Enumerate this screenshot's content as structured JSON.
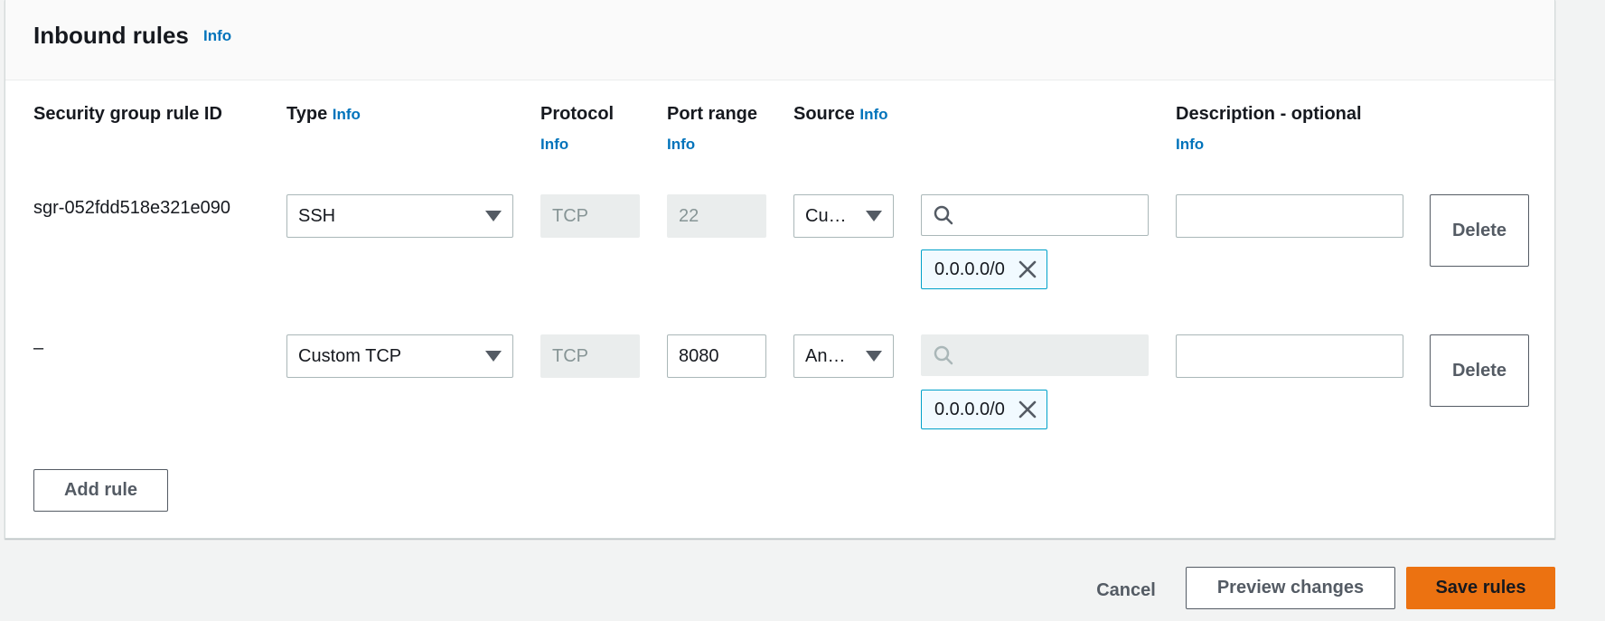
{
  "panel": {
    "title": "Inbound rules",
    "title_info": "Info"
  },
  "columns": {
    "rule_id": "Security group rule ID",
    "type": "Type",
    "type_info": "Info",
    "protocol": "Protocol",
    "protocol_info": "Info",
    "port_range": "Port range",
    "port_range_info": "Info",
    "source": "Source",
    "source_info": "Info",
    "description": "Description - optional",
    "description_info": "Info"
  },
  "rules": [
    {
      "rule_id": "sgr-052fdd518e321e090",
      "type": "SSH",
      "protocol": "TCP",
      "port_range": "22",
      "source_select": "Cu…",
      "search_value": "",
      "cidr_token": "0.0.0.0/0",
      "description": "",
      "delete_label": "Delete"
    },
    {
      "rule_id": "–",
      "type": "Custom TCP",
      "protocol": "TCP",
      "port_range": "8080",
      "source_select": "An…",
      "search_value": "",
      "cidr_token": "0.0.0.0/0",
      "description": "",
      "delete_label": "Delete"
    }
  ],
  "add_rule_label": "Add rule",
  "footer": {
    "cancel_label": "Cancel",
    "preview_label": "Preview changes",
    "save_label": "Save rules"
  },
  "colors": {
    "info_link": "#0073bb",
    "primary_button": "#ec7211",
    "token_border": "#00a1c9",
    "token_background": "#f1faff"
  },
  "icons": {
    "search": "search-icon",
    "caret": "caret-down-icon",
    "remove": "close-icon"
  }
}
